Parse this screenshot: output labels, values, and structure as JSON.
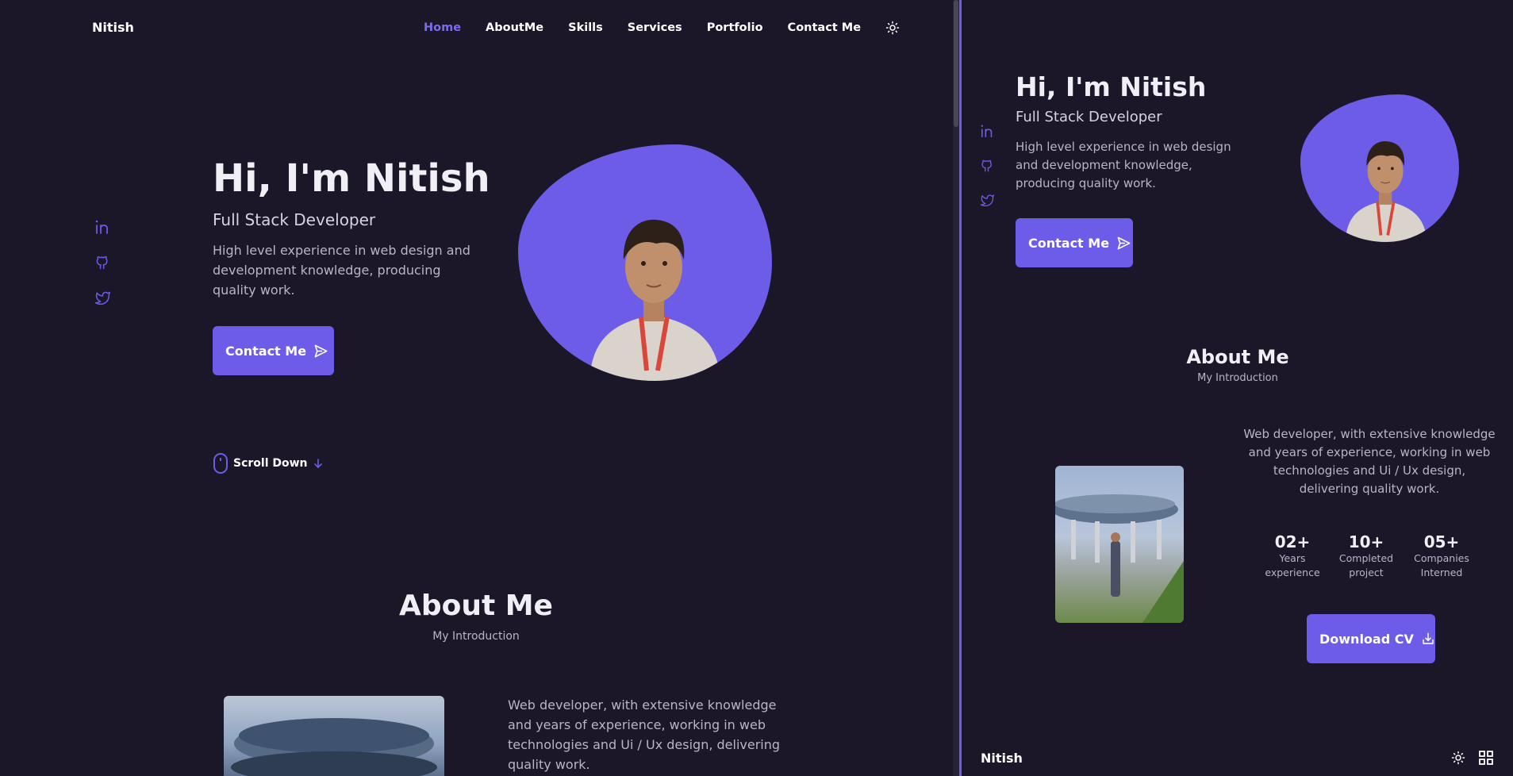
{
  "nav": {
    "logo": "Nitish",
    "links": [
      {
        "label": "Home",
        "active": true
      },
      {
        "label": "AboutMe"
      },
      {
        "label": "Skills"
      },
      {
        "label": "Services"
      },
      {
        "label": "Portfolio"
      },
      {
        "label": "Contact Me"
      }
    ],
    "theme_icon": "sun-icon"
  },
  "social": [
    {
      "name": "linkedin",
      "icon": "linkedin-icon"
    },
    {
      "name": "github",
      "icon": "github-icon"
    },
    {
      "name": "twitter",
      "icon": "twitter-icon"
    }
  ],
  "hero": {
    "title": "Hi, I'm Nitish",
    "subtitle": "Full Stack Developer",
    "description": "High level experience in web design and development knowledge, producing quality work.",
    "contact_button": "Contact Me",
    "scroll_label": "Scroll Down"
  },
  "about": {
    "title": "About Me",
    "subtitle": "My Introduction",
    "description": "Web developer, with extensive knowledge and years of experience, working in web technologies and Ui / Ux design, delivering quality work.",
    "stats": [
      {
        "value": "02+",
        "label": "Years\nexperience"
      },
      {
        "value": "10+",
        "label": "Completed\nproject"
      },
      {
        "value": "05+",
        "label": "Companies\nInterned"
      }
    ],
    "download_button": "Download CV"
  },
  "mobile_footer": {
    "logo": "Nitish"
  },
  "colors": {
    "background": "#1b1728",
    "accent": "#6c5ce7",
    "text": "#f1eff6",
    "muted_text": "#b9b4c8"
  }
}
